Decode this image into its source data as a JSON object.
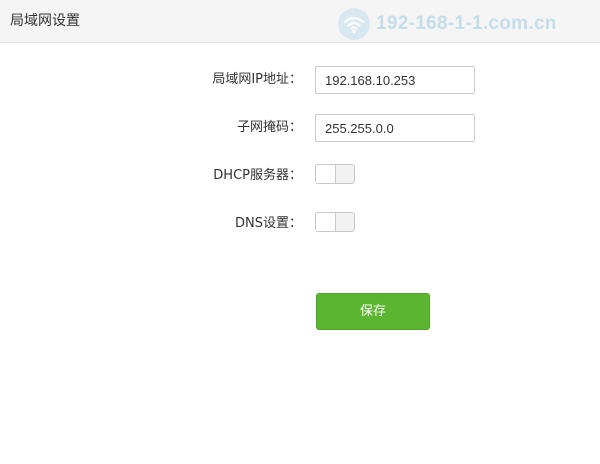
{
  "header": {
    "title": "局域网设置",
    "watermark_text": "192-168-1-1.com.cn",
    "watermark_icon": "wifi-icon"
  },
  "form": {
    "lan_ip": {
      "label": "局域网IP地址：",
      "value": "192.168.10.253"
    },
    "subnet_mask": {
      "label": "子网掩码：",
      "value": "255.255.0.0"
    },
    "dhcp_server": {
      "label": "DHCP服务器：",
      "enabled": false
    },
    "dns_settings": {
      "label": "DNS设置：",
      "enabled": false
    }
  },
  "actions": {
    "save_label": "保存"
  },
  "colors": {
    "header_bg": "#f5f5f5",
    "save_button": "#5cb531",
    "watermark": "#bcd9ea"
  }
}
